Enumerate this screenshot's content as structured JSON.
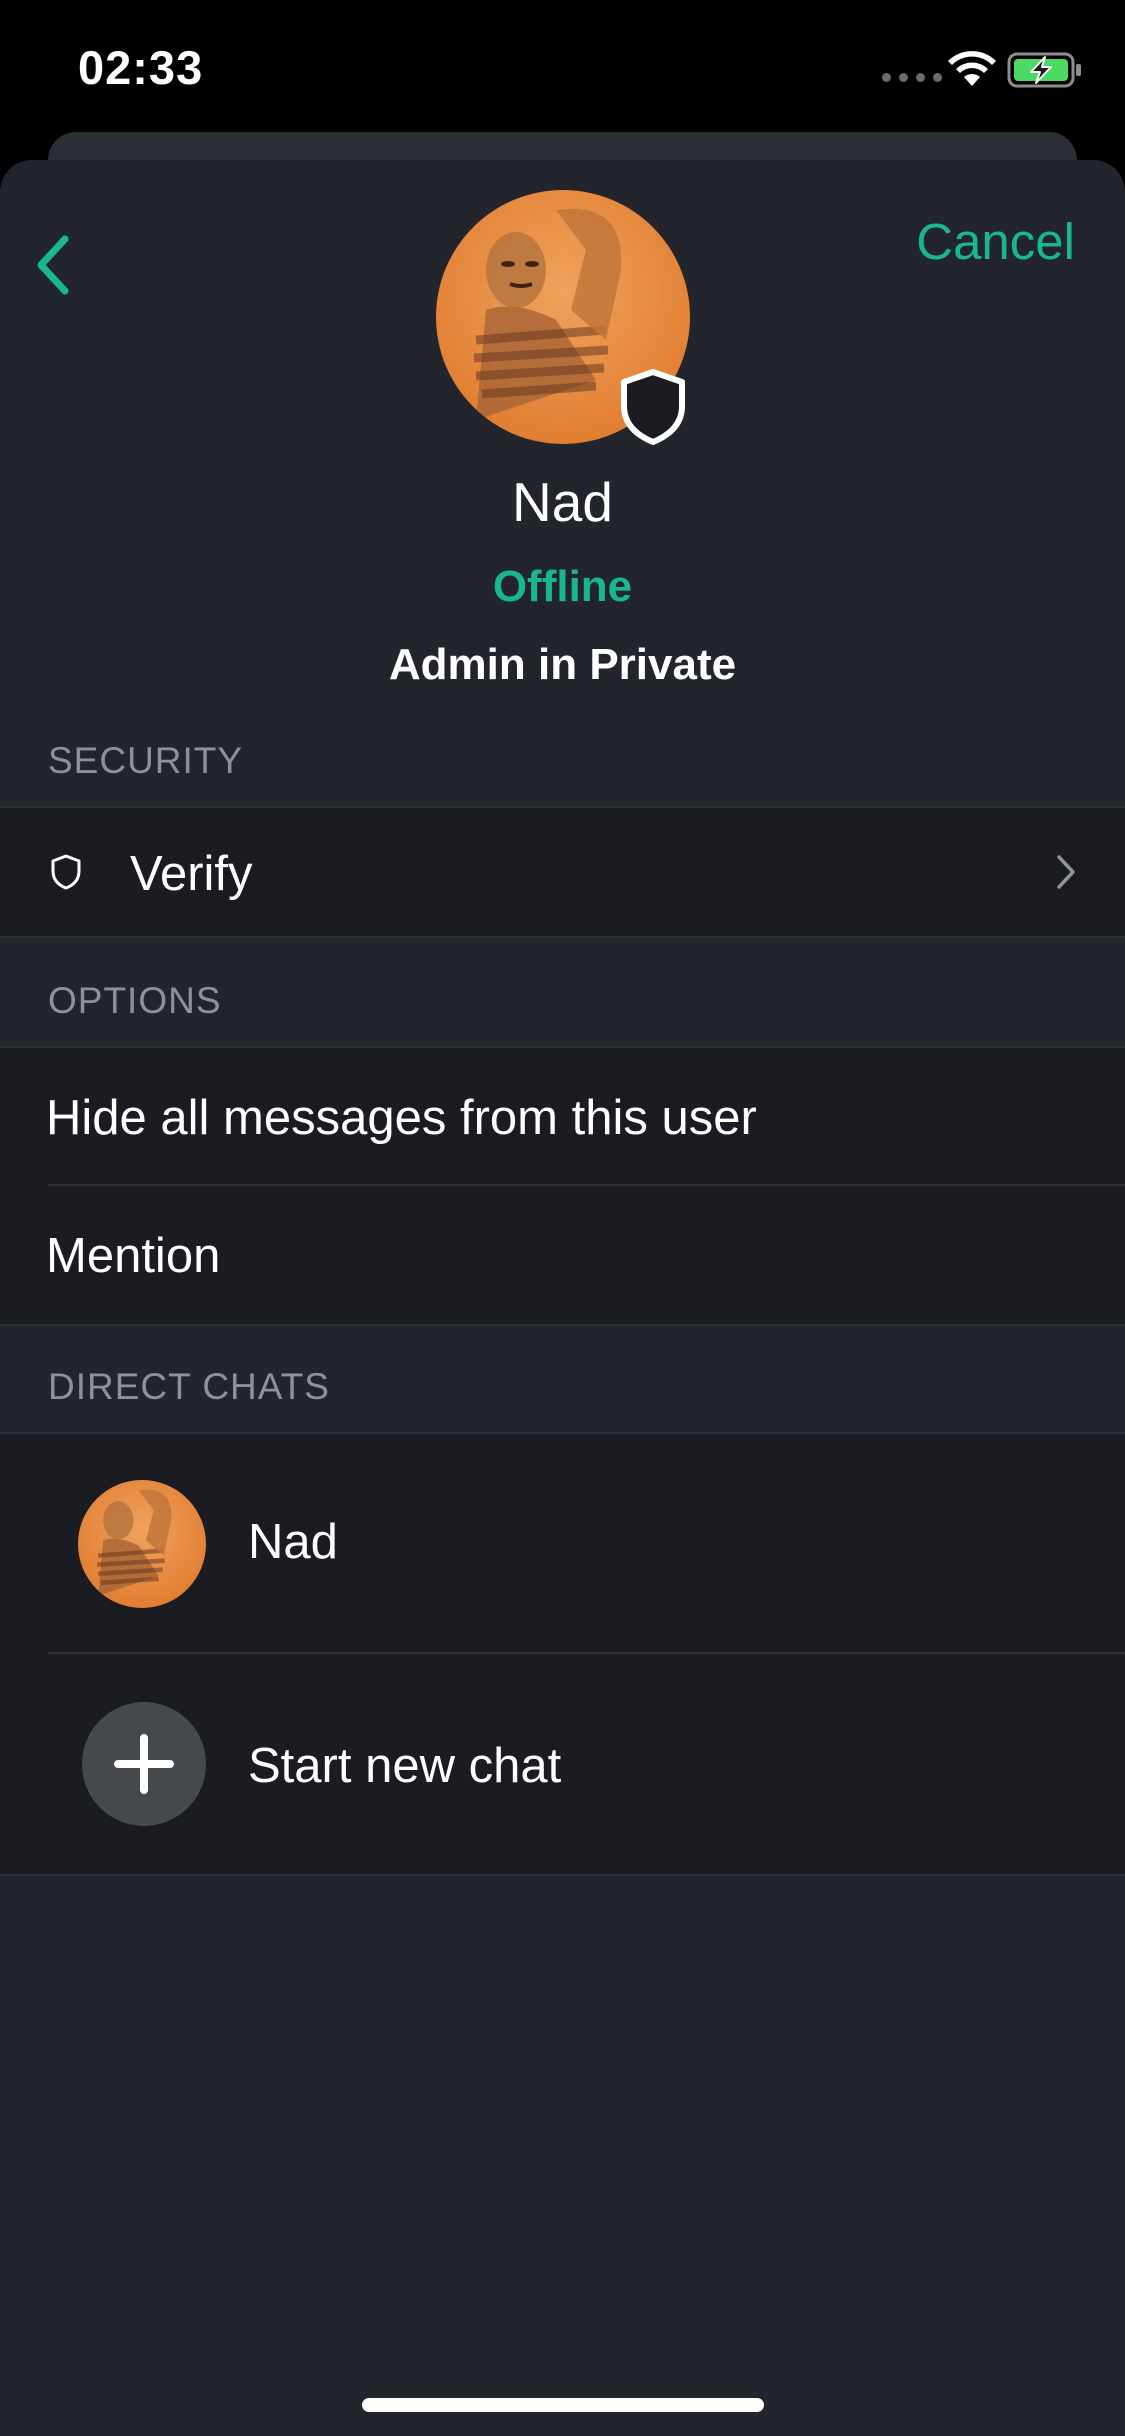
{
  "status_bar": {
    "time": "02:33"
  },
  "header": {
    "cancel_label": "Cancel",
    "back_icon": "chevron-left-icon"
  },
  "profile": {
    "name": "Nad",
    "status": "Offline",
    "role": "Admin in Private",
    "badge_icon": "shield-icon"
  },
  "sections": {
    "security": {
      "title": "SECURITY",
      "items": [
        {
          "label": "Verify",
          "icon": "shield-icon",
          "accessory": "chevron-right-icon"
        }
      ]
    },
    "options": {
      "title": "OPTIONS",
      "items": [
        {
          "label": "Hide all messages from this user"
        },
        {
          "label": "Mention"
        }
      ]
    },
    "direct_chats": {
      "title": "DIRECT CHATS",
      "items": [
        {
          "label": "Nad",
          "icon": "avatar"
        },
        {
          "label": "Start new chat",
          "icon": "plus-icon"
        }
      ]
    }
  },
  "colors": {
    "accent": "#19b88a",
    "sheet_background": "#22252b",
    "row_background": "#1a1c21",
    "section_header_text": "#8e9197",
    "battery_fill": "#4cd964"
  }
}
